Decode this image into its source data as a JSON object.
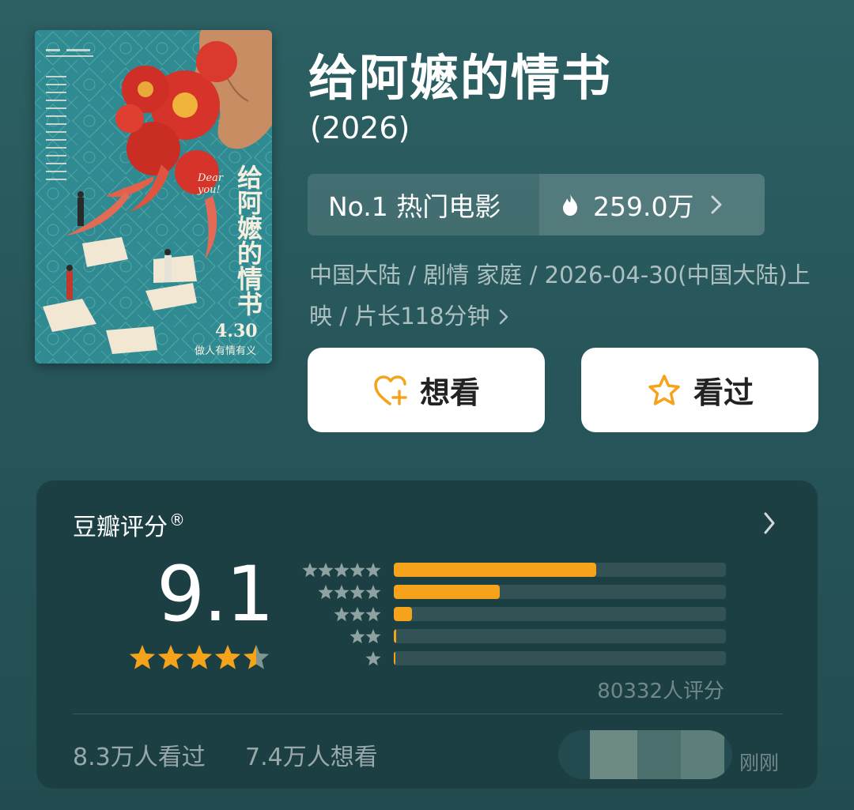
{
  "movie": {
    "title": "给阿嬷的情书",
    "year": "(2026)",
    "poster": {
      "title_text": "给阿嬷的情书",
      "english_text": "Dear you!",
      "release_text": "4.30",
      "tagline": "做人有情有义"
    },
    "hot": {
      "rank_label": "No.1 热门电影",
      "heat_value": "259.0万",
      "icon": "flame-icon"
    },
    "meta_line": "中国大陆 / 剧情 家庭 / 2026-04-30(中国大陆)上映 / 片长118分钟"
  },
  "actions": {
    "want_label": "想看",
    "seen_label": "看过"
  },
  "rating": {
    "title": "豆瓣评分",
    "registered_mark": "®",
    "score": "9.1",
    "stars": 4.5,
    "distribution": [
      {
        "stars": 5,
        "fraction": 0.61
      },
      {
        "stars": 4,
        "fraction": 0.32
      },
      {
        "stars": 3,
        "fraction": 0.055
      },
      {
        "stars": 2,
        "fraction": 0.006
      },
      {
        "stars": 1,
        "fraction": 0.004
      }
    ],
    "raters_text": "80332人评分",
    "seen_count": "8.3万人看过",
    "want_count": "7.4万人想看",
    "updated_text": "刚刚"
  },
  "colors": {
    "background": "#2c6063",
    "card": "#1b3f43",
    "accent": "#f5a31a",
    "poster_teal": "#2f8f96",
    "flower_red": "#d6342a"
  }
}
